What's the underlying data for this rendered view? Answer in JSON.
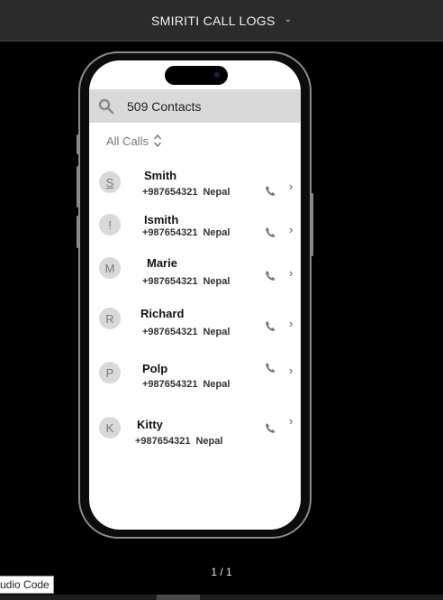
{
  "header": {
    "title": "SMIRITI CALL LOGS",
    "menu_icon": "chevron-down-icon"
  },
  "search": {
    "label": "509 Contacts",
    "icon": "search-icon"
  },
  "filter": {
    "label": "All Calls",
    "icon": "sort-updown-icon"
  },
  "contacts": [
    {
      "initial": "S",
      "name": "Smith",
      "number": "+987654321",
      "country": "Nepal"
    },
    {
      "initial": "!",
      "name": "Ismith",
      "number": "+987654321",
      "country": "Nepal"
    },
    {
      "initial": "M",
      "name": "Marie",
      "number": "+987654321",
      "country": "Nepal"
    },
    {
      "initial": "R",
      "name": "Richard",
      "number": "+987654321",
      "country": "Nepal"
    },
    {
      "initial": "P",
      "name": "Polp",
      "number": "+987654321",
      "country": "Nepal"
    },
    {
      "initial": "K",
      "name": "Kitty",
      "number": "+987654321",
      "country": "Nepal"
    }
  ],
  "pager": {
    "text": "1 / 1"
  },
  "tooltip": {
    "text": "udio Code"
  }
}
